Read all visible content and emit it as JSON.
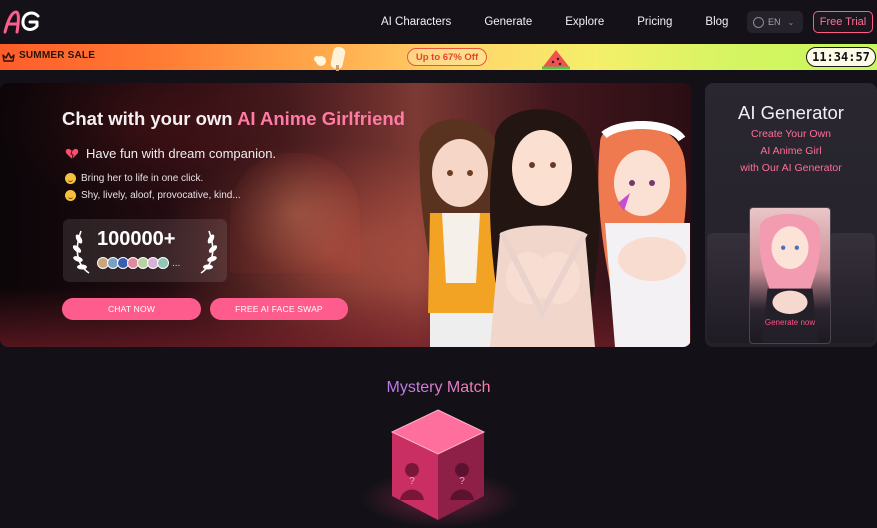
{
  "nav": {
    "logo_icon": "ag-logo-icon",
    "links": [
      "AI Characters",
      "Generate",
      "Explore",
      "Pricing",
      "Blog"
    ],
    "language": "EN",
    "free_trial": "Free Trial"
  },
  "sale": {
    "label": "SUMMER SALE",
    "offer": "Up to 67% Off",
    "timer": "11:34:57"
  },
  "hero": {
    "title_prefix": "Chat with your own ",
    "title_highlight": "AI Anime Girlfriend",
    "subtitle": "Have fun with dream companion.",
    "line1": "Bring her to life in one click.",
    "line2": "Shy, lively, aloof, provocative, kind...",
    "count": "100000+",
    "count_more": "...",
    "chat_button": "CHAT NOW",
    "swap_button": "FREE AI FACE SWAP"
  },
  "generator": {
    "title": "AI Generator",
    "line1": "Create Your Own",
    "line2": "AI Anime Girl",
    "line3": "with Our AI Generator",
    "button": "Generate now"
  },
  "mystery": {
    "title": "Mystery Match"
  },
  "colors": {
    "accent": "#ff5c8e",
    "background": "#131117"
  }
}
